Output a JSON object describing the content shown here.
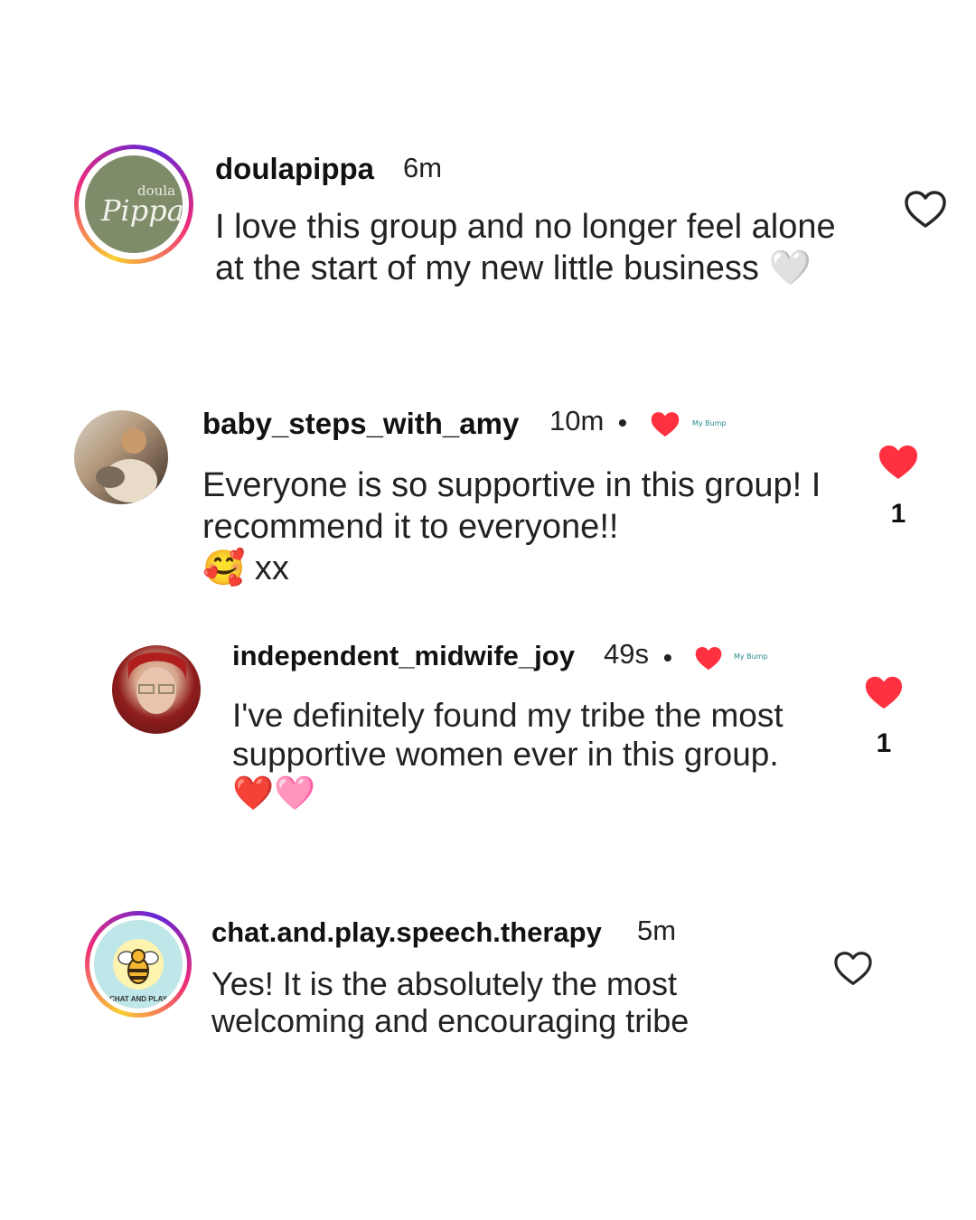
{
  "comments": [
    {
      "username": "doulapippa",
      "time": "6m",
      "text": "I love this group and no longer feel alone at the start of my new little business",
      "emoji": "🤍",
      "avatar_text_top": "doula",
      "avatar_text_main": "Pippa",
      "liked": false
    },
    {
      "username": "baby_steps_with_amy",
      "time": "10m",
      "bullet": "•",
      "text": "Everyone is so supportive in this group! I recommend it to everyone!!",
      "emoji_text": "🥰 xx",
      "creator_badge": "My Bump",
      "liked": true,
      "like_count": "1"
    },
    {
      "username": "independent_midwife_joy",
      "time": "49s",
      "bullet": "•",
      "text": "I've definitely found my tribe the most supportive women ever in this group.",
      "emoji": "❤️🩷",
      "creator_badge": "My Bump",
      "liked": true,
      "like_count": "1"
    },
    {
      "username": "chat.and.play.speech.therapy",
      "time": "5m",
      "text": "Yes! It is the absolutely the most welcoming and encouraging tribe",
      "avatar_text": "CHAT AND PLAY",
      "liked": false
    }
  ],
  "colors": {
    "like_red": "#ff3040",
    "outline": "#262626"
  }
}
